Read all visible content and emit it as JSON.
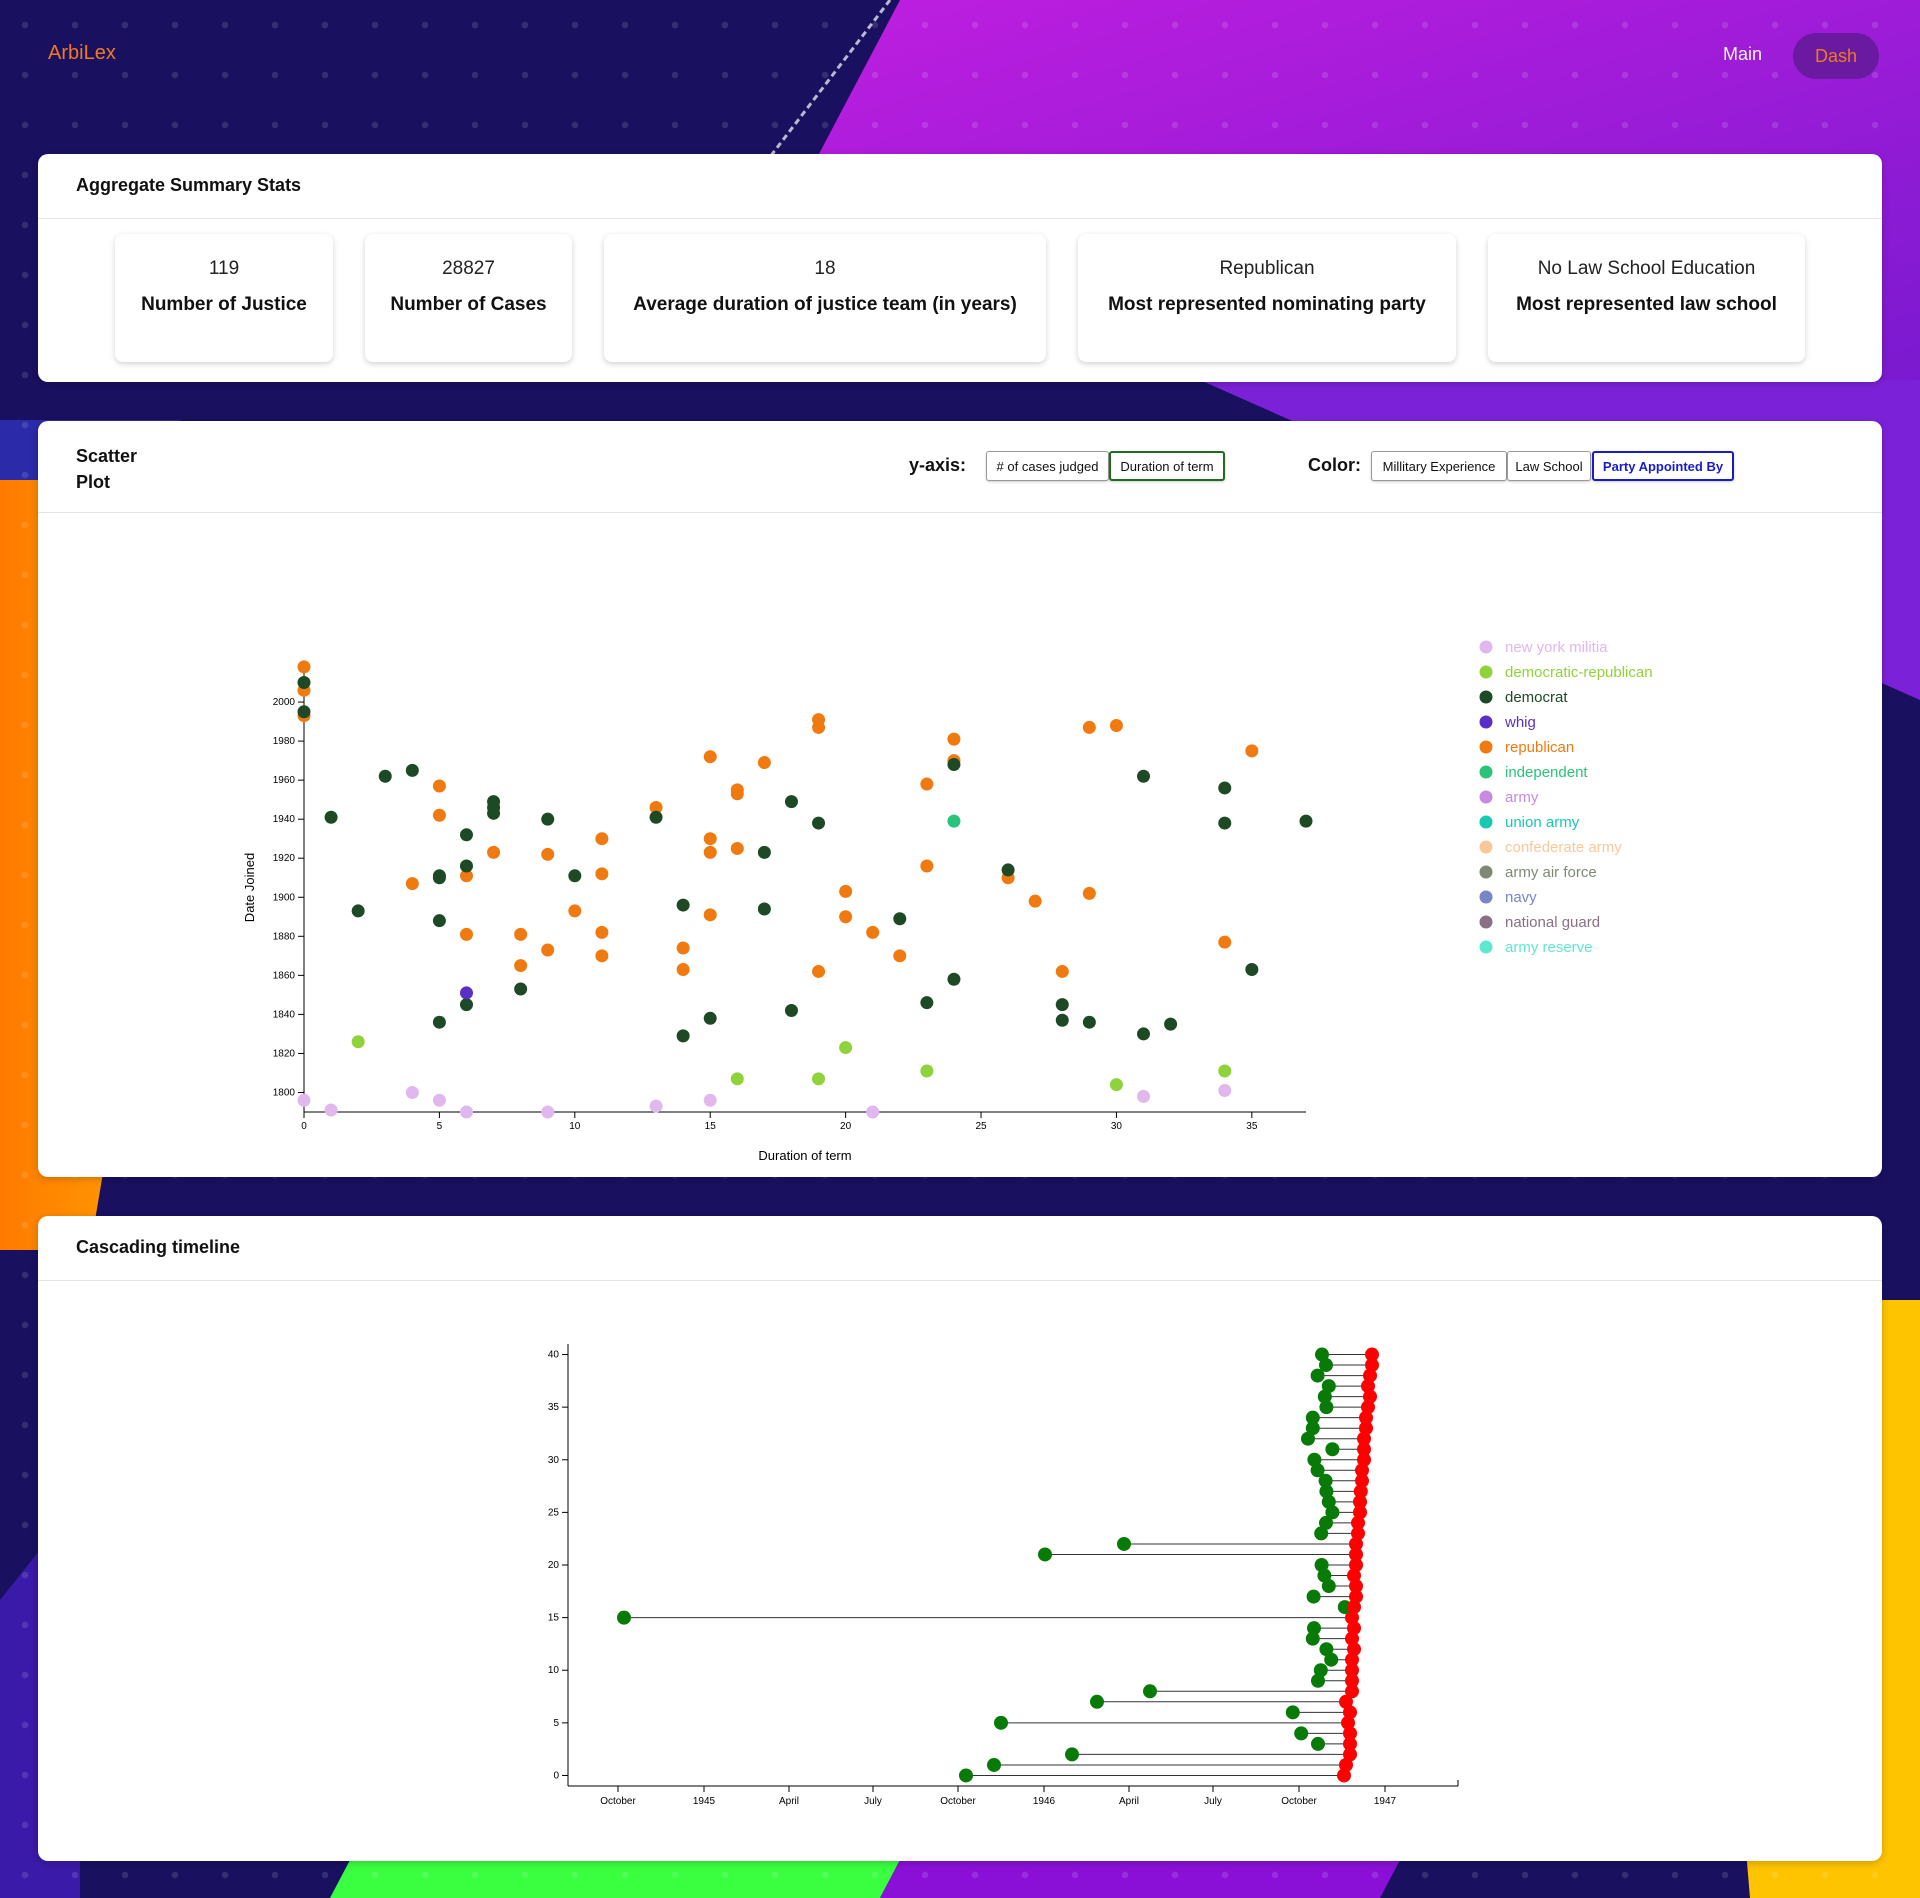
{
  "nav": {
    "brand": "ArbiLex",
    "main_label": "Main",
    "dash_label": "Dash"
  },
  "colors": {
    "accent": "#f07a1e",
    "nav_pill": "#6a1aa0",
    "start_dot": "#087a08",
    "end_dot": "#ff0000"
  },
  "summary": {
    "title": "Aggregate Summary Stats",
    "stats": [
      {
        "value": "119",
        "label": "Number of Justice"
      },
      {
        "value": "28827",
        "label": "Number of Cases"
      },
      {
        "value": "18",
        "label": "Average duration of justice team (in years)"
      },
      {
        "value": "Republican",
        "label": "Most represented nominating party"
      },
      {
        "value": "No Law School Education",
        "label": "Most represented law school"
      }
    ]
  },
  "scatter": {
    "title_line1": "Scatter",
    "title_line2": "Plot",
    "yaxis_label": "y-axis:",
    "yaxis_options": [
      "# of cases judged",
      "Duration of term"
    ],
    "color_label": "Color:",
    "color_options": [
      "Millitary Experience",
      "Law School",
      "Party Appointed By"
    ],
    "legend": [
      {
        "name": "new york militia",
        "color": "#e0b8ee"
      },
      {
        "name": "democratic-republican",
        "color": "#8fd23a"
      },
      {
        "name": "democrat",
        "color": "#1d4a24"
      },
      {
        "name": "whig",
        "color": "#5a2fc8"
      },
      {
        "name": "republican",
        "color": "#f07a10"
      },
      {
        "name": "independent",
        "color": "#2ac37a"
      },
      {
        "name": "army",
        "color": "#c88ae0"
      },
      {
        "name": "union army",
        "color": "#17c9b0"
      },
      {
        "name": "confederate army",
        "color": "#f7c99a"
      },
      {
        "name": "army air force",
        "color": "#7f8a75"
      },
      {
        "name": "navy",
        "color": "#7a85c8"
      },
      {
        "name": "national guard",
        "color": "#8a6f85"
      },
      {
        "name": "army reserve",
        "color": "#5ee8d0"
      }
    ]
  },
  "chart_data": [
    {
      "type": "scatter",
      "xlabel": "Duration of term",
      "ylabel": "Date Joined",
      "xlim": [
        0,
        37
      ],
      "ylim": [
        1790,
        2020
      ],
      "xticks": [
        0,
        5,
        10,
        15,
        20,
        25,
        30,
        35
      ],
      "yticks": [
        1800,
        1820,
        1840,
        1860,
        1880,
        1900,
        1920,
        1940,
        1960,
        1980,
        2000
      ],
      "series": [
        {
          "name": "republican",
          "color": "#f07a10",
          "points": [
            [
              0,
              2018
            ],
            [
              0,
              2006
            ],
            [
              0,
              1993
            ],
            [
              4,
              1907
            ],
            [
              5,
              1957
            ],
            [
              5,
              1942
            ],
            [
              6,
              1911
            ],
            [
              6,
              1881
            ],
            [
              7,
              1923
            ],
            [
              8,
              1881
            ],
            [
              8,
              1865
            ],
            [
              9,
              1922
            ],
            [
              9,
              1873
            ],
            [
              10,
              1893
            ],
            [
              11,
              1930
            ],
            [
              11,
              1912
            ],
            [
              11,
              1882
            ],
            [
              11,
              1870
            ],
            [
              13,
              1946
            ],
            [
              14,
              1874
            ],
            [
              14,
              1863
            ],
            [
              15,
              1972
            ],
            [
              15,
              1930
            ],
            [
              15,
              1923
            ],
            [
              15,
              1891
            ],
            [
              16,
              1955
            ],
            [
              16,
              1953
            ],
            [
              16,
              1925
            ],
            [
              17,
              1969
            ],
            [
              19,
              1991
            ],
            [
              19,
              1987
            ],
            [
              19,
              1862
            ],
            [
              20,
              1903
            ],
            [
              20,
              1890
            ],
            [
              21,
              1882
            ],
            [
              22,
              1870
            ],
            [
              23,
              1958
            ],
            [
              23,
              1916
            ],
            [
              24,
              1981
            ],
            [
              24,
              1970
            ],
            [
              26,
              1910
            ],
            [
              27,
              1898
            ],
            [
              28,
              1862
            ],
            [
              29,
              1987
            ],
            [
              29,
              1902
            ],
            [
              30,
              1988
            ],
            [
              34,
              1877
            ],
            [
              35,
              1975
            ]
          ]
        },
        {
          "name": "democrat",
          "color": "#1d4a24",
          "points": [
            [
              0,
              2010
            ],
            [
              0,
              1995
            ],
            [
              1,
              1941
            ],
            [
              2,
              1893
            ],
            [
              3,
              1962
            ],
            [
              4,
              1965
            ],
            [
              5,
              1911
            ],
            [
              5,
              1910
            ],
            [
              5,
              1888
            ],
            [
              5,
              1836
            ],
            [
              6,
              1932
            ],
            [
              6,
              1916
            ],
            [
              6,
              1845
            ],
            [
              7,
              1949
            ],
            [
              7,
              1946
            ],
            [
              7,
              1943
            ],
            [
              8,
              1853
            ],
            [
              9,
              1940
            ],
            [
              10,
              1911
            ],
            [
              13,
              1941
            ],
            [
              14,
              1896
            ],
            [
              14,
              1829
            ],
            [
              15,
              1838
            ],
            [
              17,
              1923
            ],
            [
              17,
              1894
            ],
            [
              18,
              1949
            ],
            [
              18,
              1842
            ],
            [
              19,
              1938
            ],
            [
              22,
              1889
            ],
            [
              23,
              1846
            ],
            [
              24,
              1968
            ],
            [
              24,
              1858
            ],
            [
              26,
              1914
            ],
            [
              28,
              1845
            ],
            [
              28,
              1837
            ],
            [
              29,
              1836
            ],
            [
              31,
              1962
            ],
            [
              31,
              1830
            ],
            [
              32,
              1835
            ],
            [
              34,
              1956
            ],
            [
              34,
              1938
            ],
            [
              35,
              1863
            ],
            [
              37,
              1939
            ]
          ]
        },
        {
          "name": "democratic-republican",
          "color": "#8fd23a",
          "points": [
            [
              2,
              1826
            ],
            [
              16,
              1807
            ],
            [
              19,
              1807
            ],
            [
              20,
              1823
            ],
            [
              23,
              1811
            ],
            [
              30,
              1804
            ],
            [
              34,
              1811
            ]
          ]
        },
        {
          "name": "whig",
          "color": "#5a2fc8",
          "points": [
            [
              6,
              1851
            ]
          ]
        },
        {
          "name": "independent",
          "color": "#2ac37a",
          "points": [
            [
              24,
              1939
            ]
          ]
        },
        {
          "name": "new york militia",
          "color": "#e0b8ee",
          "points": [
            [
              0,
              1796
            ],
            [
              1,
              1791
            ],
            [
              4,
              1800
            ],
            [
              5,
              1796
            ],
            [
              6,
              1790
            ],
            [
              9,
              1790
            ],
            [
              13,
              1793
            ],
            [
              15,
              1796
            ],
            [
              21,
              1790
            ],
            [
              31,
              1798
            ],
            [
              34,
              1801
            ]
          ]
        }
      ]
    },
    {
      "type": "line",
      "title": "Cascading timeline",
      "x_ticks": [
        "October",
        "1945",
        "April",
        "July",
        "October",
        "1946",
        "April",
        "July",
        "October",
        "1947"
      ],
      "ylim": [
        -1,
        41
      ],
      "yticks": [
        0,
        5,
        10,
        15,
        20,
        25,
        30,
        35,
        40
      ],
      "x_start": "1944-09-01",
      "start_months": [
        0.0,
        0.35,
        0.77,
        0.85,
        0.43,
        0.23,
        0.22,
        1.57,
        1.18,
        0.85,
        0.92,
        1.18,
        1.06,
        0.72,
        0.75,
        1.45,
        1.52,
        0.74,
        1.12,
        1.01,
        0.94,
        0.98,
        1.02,
        0.93,
        1.05,
        1.21,
        1.12,
        1.06,
        1.04,
        0.84,
        0.76,
        1.21,
        0.6,
        0.72,
        0.72,
        1.06,
        1.02,
        1.12,
        0.84,
        1.05,
        0.95
      ],
      "end_months": [
        0,
        0.05,
        0.15,
        0.15,
        0.15,
        0.1,
        0.15,
        0.05,
        0.2,
        0.2,
        0.2,
        0.2,
        0.25,
        0.2,
        0.25,
        0.2,
        0.25,
        0.3,
        0.3,
        0.25,
        0.3,
        0.3,
        0.3,
        0.35,
        0.35,
        0.4,
        0.4,
        0.42,
        0.45,
        0.45,
        0.5,
        0.5,
        0.5,
        0.55,
        0.55,
        0.6,
        0.65,
        0.6,
        0.65,
        0.7,
        0.7
      ]
    }
  ]
}
